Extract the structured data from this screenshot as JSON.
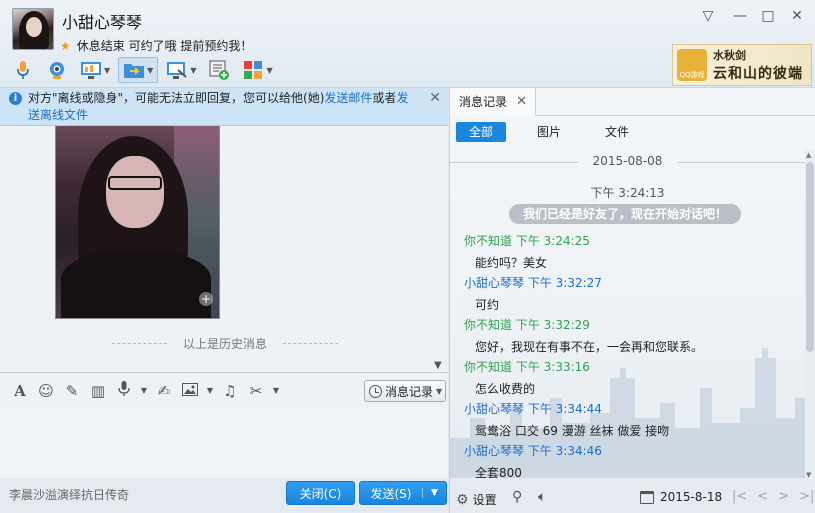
{
  "contact": {
    "name": "小甜心琴琴",
    "status": "休息结束 可约了哦 提前预约我！"
  },
  "window_controls": {
    "dropdown": "▽",
    "minimize": "—",
    "maximize": "□",
    "close": "✕"
  },
  "ad": {
    "logo_text": "QQ游戏",
    "line1": "水秋剑",
    "line2": "云和山的彼端"
  },
  "notice": {
    "text_prefix": "对方\"离线或隐身\"，可能无法立即回复，您可以给他(她)",
    "link_email": "发送邮件",
    "or": "或者",
    "link_offline": "发送离线文件"
  },
  "chat": {
    "history_separator": "以上是历史消息"
  },
  "input_toolbar": {
    "message_record_label": "消息记录"
  },
  "bottom": {
    "left_text": "李晨沙溢演绎抗日传奇",
    "close_label": "关闭(C)",
    "send_label": "发送(S)"
  },
  "right_pane": {
    "tab_label": "消息记录",
    "filter_tabs": [
      "全部",
      "图片",
      "文件"
    ],
    "date": "2015-08-08",
    "system_time": "下午 3:24:13",
    "system_message": "我们已经是好友了，现在开始对话吧！",
    "messages": [
      {
        "sender": "你不知道",
        "time": "下午 3:24:25",
        "text": "能约吗？美女",
        "color": "green"
      },
      {
        "sender": "小甜心琴琴",
        "time": "下午 3:32:27",
        "text": "可约",
        "color": "blue"
      },
      {
        "sender": "你不知道",
        "time": "下午 3:32:29",
        "text": "您好，我现在有事不在，一会再和您联系。",
        "color": "green"
      },
      {
        "sender": "你不知道",
        "time": "下午 3:33:16",
        "text": "怎么收费的",
        "color": "green"
      },
      {
        "sender": "小甜心琴琴",
        "time": "下午 3:34:44",
        "text": "鸳鸯浴 口交 69 漫游 丝袜  做爱 接吻",
        "color": "blue"
      },
      {
        "sender": "小甜心琴琴",
        "time": "下午 3:34:46",
        "text": "全套800",
        "color": "blue"
      }
    ],
    "settings_label": "设置",
    "calendar_date": "2015-8-18"
  },
  "colors": {
    "accent_blue": "#1a86dc",
    "sender_green": "#2ea44e",
    "sender_blue": "#1a6fc7"
  }
}
